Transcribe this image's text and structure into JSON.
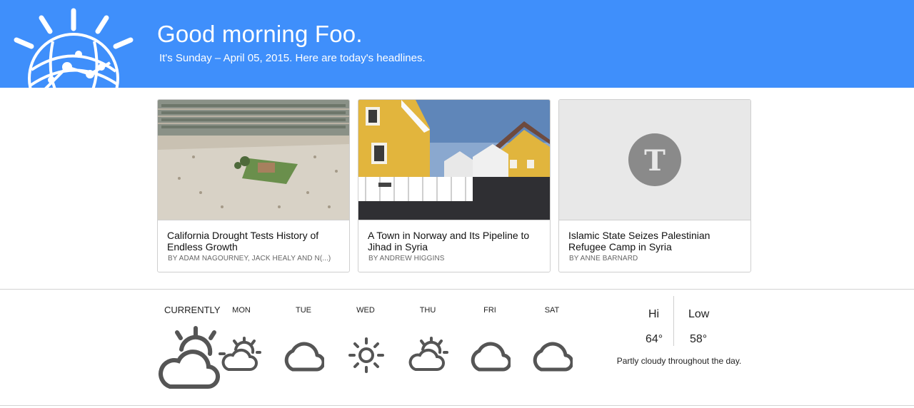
{
  "header": {
    "greeting": "Good morning Foo.",
    "subline": "It's Sunday – April 05, 2015. Here are today's headlines."
  },
  "articles": [
    {
      "headline": "California Drought Tests History of Endless Growth",
      "byline": "By ADAM NAGOURNEY, JACK HEALY and N(...)",
      "thumb": "desert-aerial-image"
    },
    {
      "headline": "A Town in Norway and Its Pipeline to Jihad in Syria",
      "byline": "By ANDREW HIGGINS",
      "thumb": "norway-houses-image"
    },
    {
      "headline": "Islamic State Seizes Palestinian Refugee Camp in Syria",
      "byline": "By ANNE BARNARD",
      "thumb": "nyt-logo-placeholder"
    }
  ],
  "weather": {
    "current_label": "CURRENTLY",
    "current_icon": "partly-cloudy-icon",
    "days": [
      {
        "label": "MON",
        "icon": "partly-cloudy-icon"
      },
      {
        "label": "TUE",
        "icon": "cloud-icon"
      },
      {
        "label": "WED",
        "icon": "sun-icon"
      },
      {
        "label": "THU",
        "icon": "partly-cloudy-icon"
      },
      {
        "label": "FRI",
        "icon": "cloud-icon"
      },
      {
        "label": "SAT",
        "icon": "cloud-icon"
      }
    ],
    "hi_label": "Hi",
    "low_label": "Low",
    "hi_value": "64°",
    "low_value": "58°",
    "summary": "Partly cloudy throughout the day."
  },
  "colors": {
    "header_bg": "#3f8ffb",
    "icon_gray": "#555555",
    "nyt_badge": "#8a8a8a"
  }
}
